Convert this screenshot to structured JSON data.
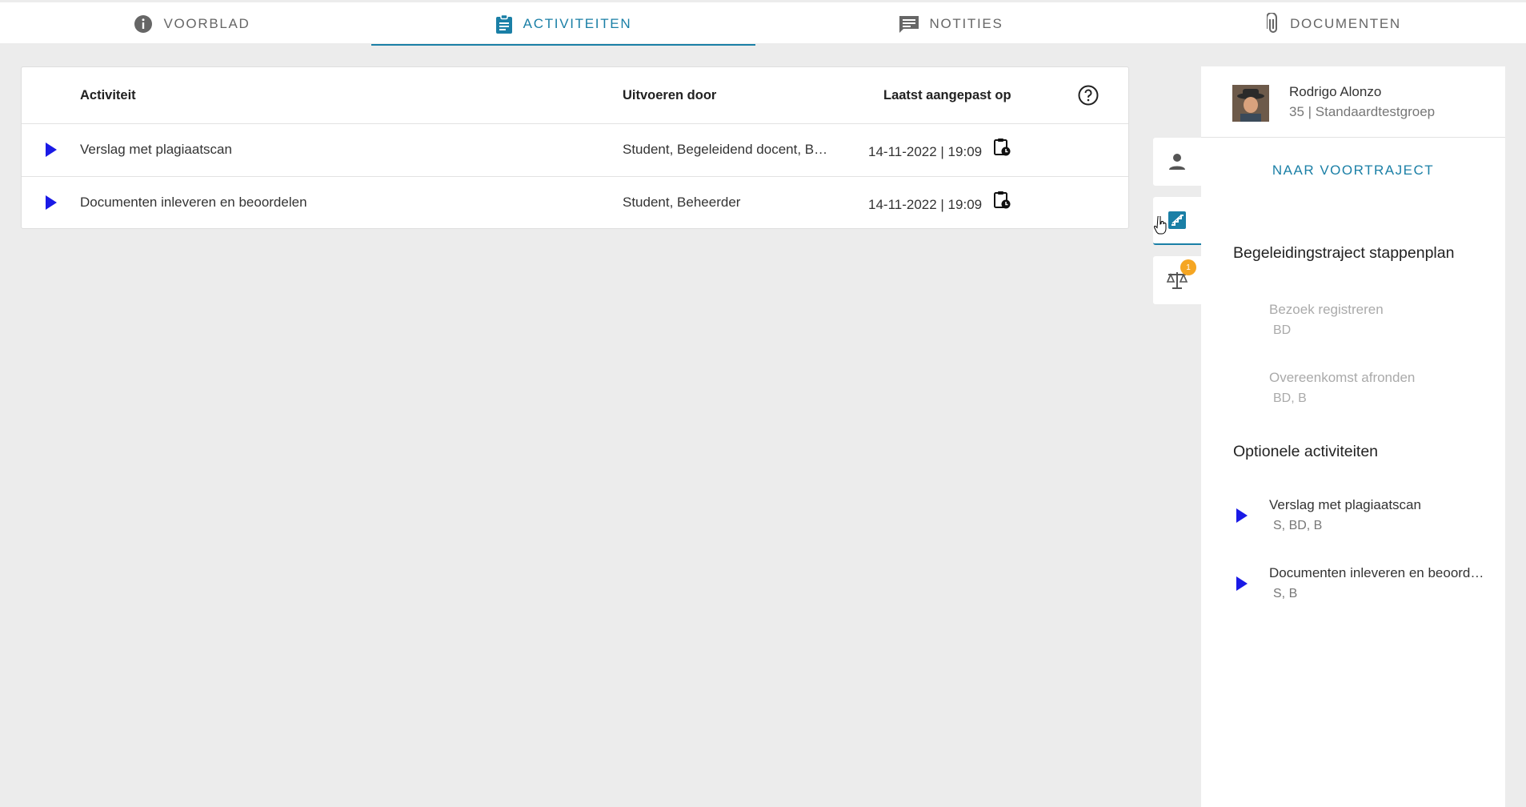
{
  "tabs": [
    {
      "label": "VOORBLAD",
      "icon": "info-icon"
    },
    {
      "label": "ACTIVITEITEN",
      "icon": "clipboard-icon",
      "active": true
    },
    {
      "label": "NOTITIES",
      "icon": "notes-icon"
    },
    {
      "label": "DOCUMENTEN",
      "icon": "paperclip-icon"
    }
  ],
  "table": {
    "headers": {
      "activiteit": "Activiteit",
      "uitvoeren_door": "Uitvoeren door",
      "laatst_aangepast": "Laatst aangepast op"
    },
    "rows": [
      {
        "activiteit": "Verslag met plagiaatscan",
        "uitvoeren_door": "Student, Begeleidend docent, Beheerder",
        "datum": "14-11-2022 | 19:09"
      },
      {
        "activiteit": "Documenten inleveren en beoordelen",
        "uitvoeren_door": "Student, Beheerder",
        "datum": "14-11-2022 | 19:09"
      }
    ]
  },
  "side_tabs": {
    "badge_count": "1"
  },
  "panel": {
    "user_name": "Rodrigo Alonzo",
    "user_group": "35 | Standaardtestgroep",
    "voortraject_label": "NAAR VOORTRAJECT",
    "section1_title": "Begeleidingstraject stappenplan",
    "section1_steps": [
      {
        "title": "Bezoek registreren",
        "sub": "BD"
      },
      {
        "title": "Overeenkomst afronden",
        "sub": "BD, B"
      }
    ],
    "section2_title": "Optionele activiteiten",
    "section2_steps": [
      {
        "title": "Verslag met plagiaatscan",
        "sub": "S, BD, B"
      },
      {
        "title": "Documenten inleveren en beoordelen",
        "sub": "S, B"
      }
    ]
  },
  "colors": {
    "accent": "#1a7fa6",
    "play": "#1a1ae6",
    "badge": "#f5a623"
  }
}
